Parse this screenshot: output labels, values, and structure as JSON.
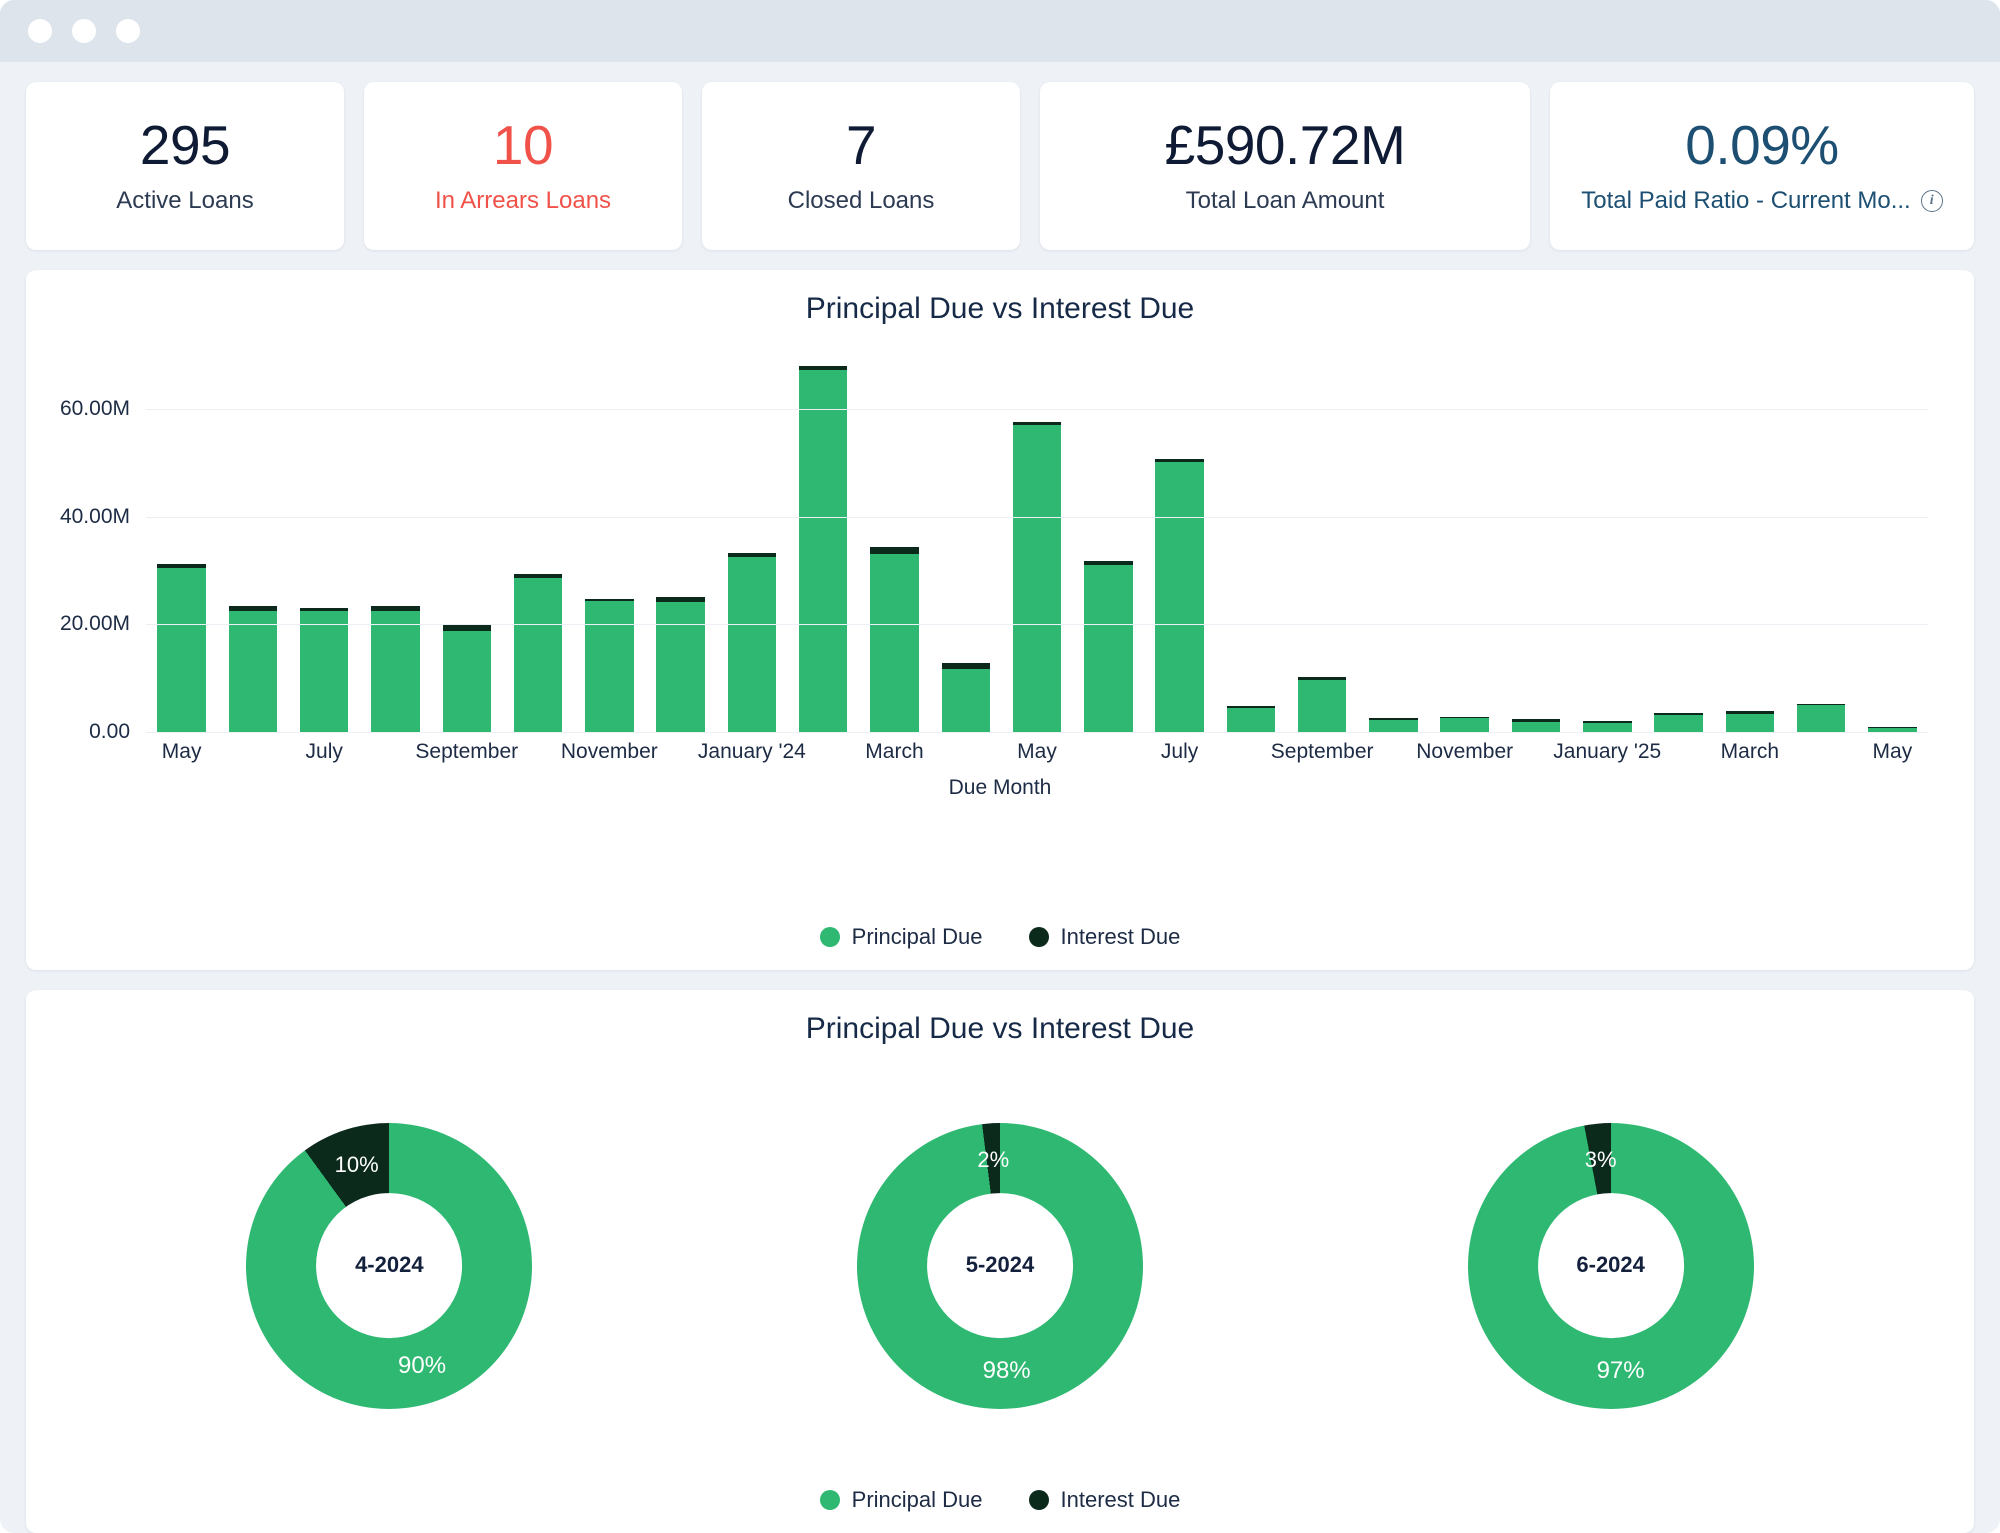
{
  "window": {
    "chrome_dots": 3,
    "titlebar_color": "#dde4ec"
  },
  "kpis": [
    {
      "value": "295",
      "label": "Active Loans",
      "tone": "default",
      "info": false
    },
    {
      "value": "10",
      "label": "In Arrears Loans",
      "tone": "danger",
      "info": false
    },
    {
      "value": "7",
      "label": "Closed Loans",
      "tone": "default",
      "info": false
    },
    {
      "value": "£590.72M",
      "label": "Total Loan Amount",
      "tone": "default",
      "info": false
    },
    {
      "value": "0.09%",
      "label": "Total Paid Ratio - Current Mo...",
      "tone": "info",
      "info": true,
      "info_icon": "info-circle-icon"
    }
  ],
  "colors": {
    "principal": "#2eb872",
    "interest": "#0c2a1c",
    "danger": "#f0524a",
    "info": "#1c4f72",
    "text": "#1d2b45"
  },
  "bar_panel": {
    "title": "Principal Due vs Interest Due"
  },
  "donut_panel": {
    "title": "Principal Due vs Interest Due"
  },
  "legend": [
    {
      "label": "Principal Due",
      "color": "#2eb872",
      "icon": "legend-dot-icon"
    },
    {
      "label": "Interest Due",
      "color": "#0c2a1c",
      "icon": "legend-dot-icon"
    }
  ],
  "chart_data": [
    {
      "type": "bar",
      "stacked": true,
      "title": "Principal Due vs Interest Due",
      "xlabel": "Due Month",
      "ylabel": "",
      "ylim": [
        0,
        71000000
      ],
      "yticks": [
        0,
        20000000,
        40000000,
        60000000
      ],
      "ytick_labels": [
        "0.00",
        "20.00M",
        "40.00M",
        "60.00M"
      ],
      "grid": true,
      "legend_position": "bottom",
      "categories": [
        "May '23",
        "June '23",
        "July '23",
        "August '23",
        "September '23",
        "October '23",
        "November '23",
        "December '23",
        "January '24",
        "February '24",
        "March '24",
        "April '24",
        "May '24",
        "June '24",
        "July '24",
        "August '24",
        "September '24",
        "October '24",
        "November '24",
        "December '24",
        "January '25",
        "February '25",
        "March '25",
        "April '25",
        "May '25"
      ],
      "xtick_labels": [
        "May",
        "",
        "July",
        "",
        "September",
        "",
        "November",
        "",
        "January '24",
        "",
        "March",
        "",
        "May",
        "",
        "July",
        "",
        "September",
        "",
        "November",
        "",
        "January '25",
        "",
        "March",
        "",
        "May"
      ],
      "series": [
        {
          "name": "Principal Due",
          "color": "#2eb872",
          "values": [
            30400000,
            22400000,
            22400000,
            22400000,
            18700000,
            28600000,
            24300000,
            24100000,
            32600000,
            67200000,
            33100000,
            11800000,
            57000000,
            31000000,
            50200000,
            4500000,
            9700000,
            2300000,
            2600000,
            1900000,
            1700000,
            3100000,
            3300000,
            5000000,
            800000
          ]
        },
        {
          "name": "Interest Due",
          "color": "#0c2a1c",
          "values": [
            900000,
            1100000,
            700000,
            1100000,
            1200000,
            700000,
            500000,
            1000000,
            600000,
            900000,
            1200000,
            1100000,
            700000,
            700000,
            500000,
            300000,
            500000,
            300000,
            200000,
            500000,
            400000,
            400000,
            600000,
            200000,
            100000
          ]
        }
      ]
    },
    {
      "type": "pie",
      "variant": "donut",
      "title": "Principal Due vs Interest Due",
      "legend_position": "bottom",
      "charts": [
        {
          "center_label": "4-2024",
          "labels": [
            "Principal Due",
            "Interest Due"
          ],
          "values": [
            90,
            10
          ],
          "value_labels": [
            "90%",
            "10%"
          ],
          "colors": [
            "#2eb872",
            "#0c2a1c"
          ]
        },
        {
          "center_label": "5-2024",
          "labels": [
            "Principal Due",
            "Interest Due"
          ],
          "values": [
            98,
            2
          ],
          "value_labels": [
            "98%",
            "2%"
          ],
          "colors": [
            "#2eb872",
            "#0c2a1c"
          ]
        },
        {
          "center_label": "6-2024",
          "labels": [
            "Principal Due",
            "Interest Due"
          ],
          "values": [
            97,
            3
          ],
          "value_labels": [
            "97%",
            "3%"
          ],
          "colors": [
            "#2eb872",
            "#0c2a1c"
          ]
        }
      ]
    }
  ]
}
